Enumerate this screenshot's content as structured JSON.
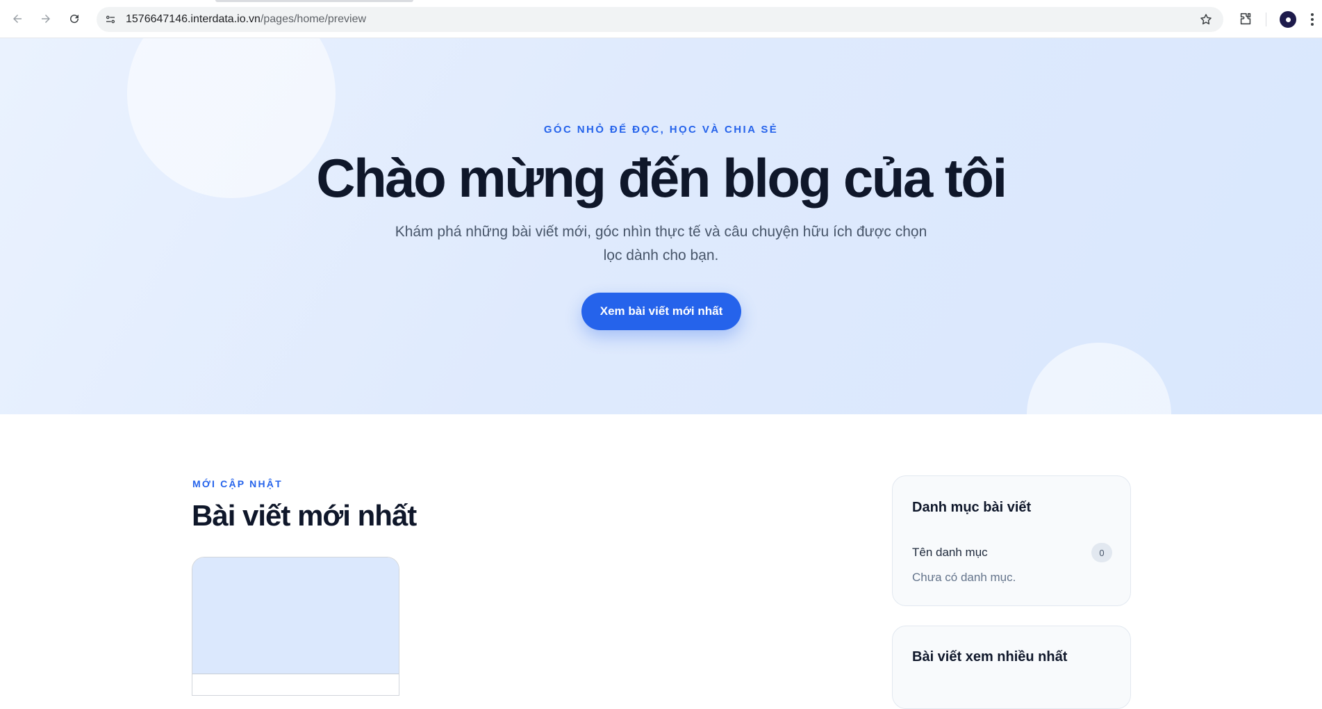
{
  "browser": {
    "url_host": "1576647146.interdata.io.vn",
    "url_path": "/pages/home/preview",
    "icons": [
      "back-arrow-icon",
      "forward-arrow-icon",
      "reload-icon",
      "site-settings-icon",
      "bookmark-star-icon",
      "extensions-icon",
      "profile-avatar-icon",
      "more-menu-icon"
    ]
  },
  "hero": {
    "eyebrow": "GÓC NHỎ ĐỂ ĐỌC, HỌC VÀ CHIA SẺ",
    "title": "Chào mừng đến blog của tôi",
    "subtitle_line1": "Khám phá những bài viết mới, góc nhìn thực tế và câu chuyện hữu ích được chọn",
    "subtitle_line2": "lọc dành cho bạn.",
    "cta_label": "Xem bài viết mới nhất"
  },
  "latest": {
    "eyebrow": "MỚI CẬP NHẬT",
    "title": "Bài viết mới nhất"
  },
  "sidebar": {
    "categories": {
      "title": "Danh mục bài viết",
      "items": [
        {
          "name": "Tên danh mục",
          "count": "0"
        }
      ],
      "empty_text": "Chưa có danh mục."
    },
    "popular": {
      "title": "Bài viết xem nhiều nhất"
    }
  },
  "colors": {
    "accent": "#2563eb",
    "heading": "#0f172a",
    "hero_bg": "#dfeafd"
  }
}
